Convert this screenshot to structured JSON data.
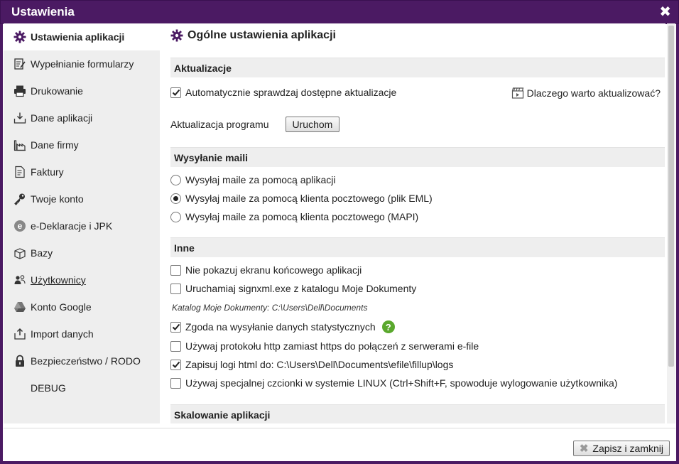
{
  "window": {
    "title": "Ustawienia",
    "close_glyph": "✖"
  },
  "sidebar": {
    "items": [
      {
        "label": "Ustawienia aplikacji",
        "icon": "gear-icon"
      },
      {
        "label": "Wypełnianie formularzy",
        "icon": "form-icon"
      },
      {
        "label": "Drukowanie",
        "icon": "printer-icon"
      },
      {
        "label": "Dane aplikacji",
        "icon": "data-download-icon"
      },
      {
        "label": "Dane firmy",
        "icon": "factory-icon"
      },
      {
        "label": "Faktury",
        "icon": "invoice-icon"
      },
      {
        "label": "Twoje konto",
        "icon": "key-icon"
      },
      {
        "label": "e-Deklaracje i JPK",
        "icon": "e-declaration-icon"
      },
      {
        "label": "Bazy",
        "icon": "box-icon"
      },
      {
        "label": "Użytkownicy",
        "icon": "users-icon"
      },
      {
        "label": "Konto Google",
        "icon": "google-drive-icon"
      },
      {
        "label": "Import danych",
        "icon": "import-icon"
      },
      {
        "label": "Bezpieczeństwo / RODO",
        "icon": "lock-icon"
      },
      {
        "label": "DEBUG",
        "icon": ""
      }
    ]
  },
  "content": {
    "title": "Ogólne ustawienia aplikacji",
    "sections": {
      "updates": {
        "header": "Aktualizacje",
        "auto_check_label": "Automatycznie sprawdzaj dostępne aktualizacje",
        "why_label": "Dlaczego warto aktualizować?",
        "program_update_label": "Aktualizacja programu",
        "run_button": "Uruchom"
      },
      "mail": {
        "header": "Wysyłanie maili",
        "opt_app": "Wysyłaj maile za pomocą aplikacji",
        "opt_eml": "Wysyłaj maile za pomocą klienta pocztowego (plik EML)",
        "opt_mapi": "Wysyłaj maile za pomocą klienta pocztowego (MAPI)"
      },
      "other": {
        "header": "Inne",
        "no_end_screen": "Nie pokazuj ekranu końcowego aplikacji",
        "run_signxml": "Uruchamiaj signxml.exe z katalogu Moje Dokumenty",
        "docs_path": "Katalog Moje Dokumenty: C:\\Users\\Dell\\Documents",
        "stats_consent": "Zgoda na wysyłanie danych statystycznych",
        "help_glyph": "?",
        "use_http": "Używaj protokołu http zamiast https do połączeń z serwerami e-file",
        "save_logs": "Zapisuj logi html do: C:\\Users\\Dell\\Documents\\efile\\fillup\\logs",
        "linux_font": "Używaj specjalnej czcionki w systemie LINUX (Ctrl+Shift+F, spowoduje wylogowanie użytkownika)"
      },
      "scaling": {
        "header": "Skalowanie aplikacji"
      }
    }
  },
  "footer": {
    "save_close": "Zapisz i zamknij",
    "save_glyph": "✖"
  },
  "colors": {
    "titlebar": "#4b1a63",
    "help": "#5aa82d"
  }
}
